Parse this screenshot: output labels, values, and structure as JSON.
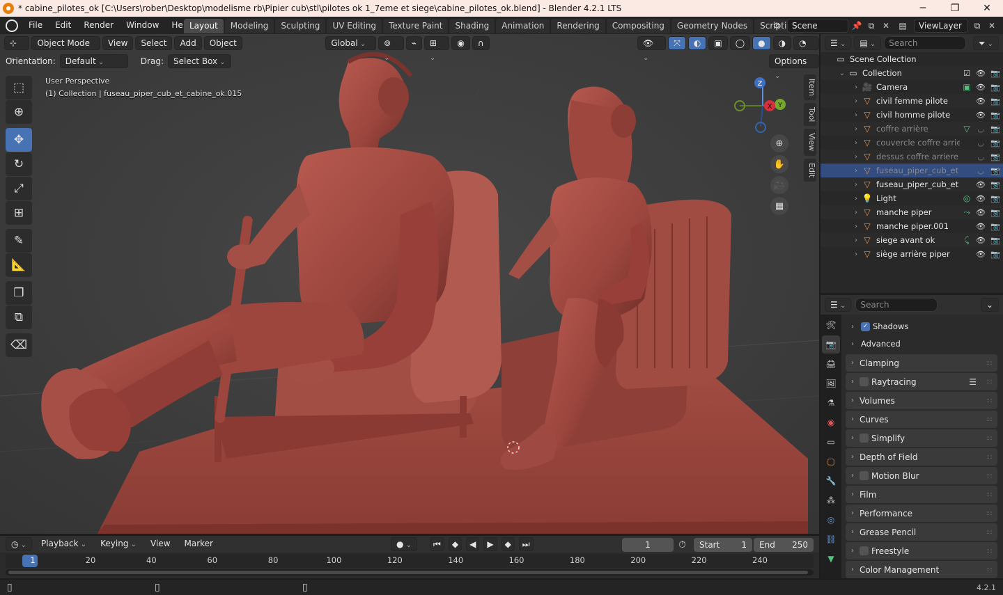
{
  "titlebar": {
    "title": "* cabine_pilotes_ok [C:\\Users\\rober\\Desktop\\modelisme rb\\Pipier cub\\stl\\pilotes ok 1_7eme et siege\\cabine_pilotes_ok.blend] - Blender 4.2.1 LTS"
  },
  "menubar": {
    "items": [
      "File",
      "Edit",
      "Render",
      "Window",
      "Help"
    ]
  },
  "workspaces": [
    "Layout",
    "Modeling",
    "Sculpting",
    "UV Editing",
    "Texture Paint",
    "Shading",
    "Animation",
    "Rendering",
    "Compositing",
    "Geometry Nodes",
    "Scripting"
  ],
  "scene": {
    "name": "Scene",
    "view_layer": "ViewLayer"
  },
  "viewport": {
    "mode": "Object Mode",
    "menus": [
      "View",
      "Select",
      "Add",
      "Object"
    ],
    "transform_orientation": "Global",
    "orientation_label": "Orientation:",
    "orientation_value": "Default",
    "drag_label": "Drag:",
    "drag_value": "Select Box",
    "options_label": "Options",
    "overlay_line1": "User Perspective",
    "overlay_line2": "(1) Collection | fuseau_piper_cub_et_cabine_ok.015",
    "side_tabs": [
      "Item",
      "Tool",
      "View",
      "Edit"
    ],
    "gizmo": {
      "z": "Z",
      "y": "Y",
      "x": "X"
    }
  },
  "outliner": {
    "search_placeholder": "Search",
    "scene_collection": "Scene Collection",
    "collection": "Collection",
    "items": [
      {
        "name": "Camera",
        "icon": "camera-icon",
        "dim": false,
        "selected": false,
        "extra": "▣"
      },
      {
        "name": "civil femme pilote",
        "icon": "mesh-icon",
        "dim": false,
        "selected": false,
        "extra": ""
      },
      {
        "name": "civil homme pilote",
        "icon": "mesh-icon",
        "dim": false,
        "selected": false,
        "extra": ""
      },
      {
        "name": "coffre arrière",
        "icon": "mesh-icon",
        "dim": true,
        "selected": false,
        "extra": "▽"
      },
      {
        "name": "couvercle coffre arrie",
        "icon": "mesh-icon",
        "dim": true,
        "selected": false,
        "extra": ""
      },
      {
        "name": "dessus coffre arriere",
        "icon": "mesh-icon",
        "dim": true,
        "selected": false,
        "extra": ""
      },
      {
        "name": "fuseau_piper_cub_et",
        "icon": "mesh-icon",
        "dim": true,
        "selected": true,
        "extra": ""
      },
      {
        "name": "fuseau_piper_cub_et",
        "icon": "mesh-icon",
        "dim": false,
        "selected": false,
        "extra": ""
      },
      {
        "name": "Light",
        "icon": "light-icon",
        "dim": false,
        "selected": false,
        "extra": "◎"
      },
      {
        "name": "manche piper",
        "icon": "mesh-icon",
        "dim": false,
        "selected": false,
        "extra": "⤳"
      },
      {
        "name": "manche piper.001",
        "icon": "mesh-icon",
        "dim": false,
        "selected": false,
        "extra": ""
      },
      {
        "name": "siege avant ok",
        "icon": "mesh-icon",
        "dim": false,
        "selected": false,
        "extra": "⤹"
      },
      {
        "name": "siège arrière piper",
        "icon": "mesh-icon",
        "dim": false,
        "selected": false,
        "extra": ""
      }
    ]
  },
  "properties": {
    "search_placeholder": "Search",
    "sub_items": [
      {
        "label": "Shadows",
        "checked": true
      },
      {
        "label": "Advanced",
        "checked": null
      }
    ],
    "panels": [
      {
        "label": "Clamping",
        "checkbox": false
      },
      {
        "label": "Raytracing",
        "checkbox": true
      },
      {
        "label": "Volumes",
        "checkbox": false
      },
      {
        "label": "Curves",
        "checkbox": false
      },
      {
        "label": "Simplify",
        "checkbox": true
      },
      {
        "label": "Depth of Field",
        "checkbox": false
      },
      {
        "label": "Motion Blur",
        "checkbox": true
      },
      {
        "label": "Film",
        "checkbox": false
      },
      {
        "label": "Performance",
        "checkbox": false
      },
      {
        "label": "Grease Pencil",
        "checkbox": false
      },
      {
        "label": "Freestyle",
        "checkbox": true
      },
      {
        "label": "Color Management",
        "checkbox": false
      }
    ]
  },
  "timeline": {
    "menus": [
      "Playback",
      "Keying",
      "View",
      "Marker"
    ],
    "current_frame": "1",
    "start_label": "Start",
    "start_value": "1",
    "end_label": "End",
    "end_value": "250",
    "ticks": [
      "1",
      "20",
      "40",
      "60",
      "80",
      "100",
      "120",
      "140",
      "160",
      "180",
      "200",
      "220",
      "240"
    ]
  },
  "statusbar": {
    "version": "4.2.1"
  },
  "colors": {
    "accent": "#4772b3",
    "model": "#9e4a42",
    "title_bg": "#fbe9e4",
    "selected_row": "#334d80"
  }
}
